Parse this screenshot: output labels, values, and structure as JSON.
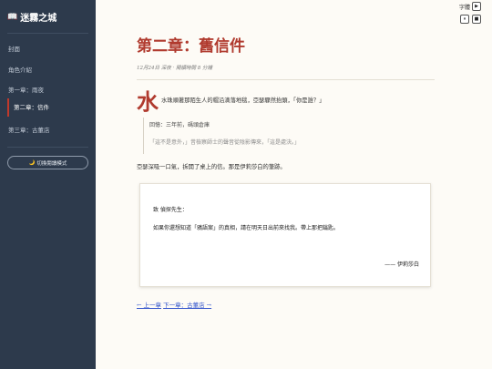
{
  "sidebar": {
    "brand_icon": "open-book-icon",
    "brand_icon_glyph": "📖",
    "brand_title": "迷霧之城",
    "items": [
      {
        "label": "封面"
      },
      {
        "label": "角色介紹"
      },
      {
        "label": "第一章：雨夜"
      },
      {
        "label": "第二章：信件"
      },
      {
        "label": "第三章：古董店"
      }
    ],
    "mode_icon": "🌙",
    "mode_label": "切換閱讀模式"
  },
  "controls": {
    "font_label": "字體",
    "play_glyph": "▶",
    "pause_glyph": "⏸",
    "stop_glyph": "■"
  },
  "chapter": {
    "title": "第二章：舊信件",
    "meta": "12月24日 深夜 · 閱讀時間 8 分鐘",
    "dropcap": "水",
    "para1": "水珠順著那陌生人的帽沿滴落地毯，亞瑟驟然抬頭，「你是誰？」",
    "flashback_heading": "回憶：三年前，碼頭倉庫",
    "flashback_quote": "「這不是意外，」昔檢察師士的聲音從陰影傳來，「這是處決。」",
    "para2": "亞瑟深吸一口氣，拆開了桌上的信。那是伊莉莎白的筆跡。"
  },
  "letter": {
    "greeting": "致 偵探先生：",
    "body": "如果你還想知道「鴉語案」的真相，請在明天日出前來找我。帶上那把鑰匙。",
    "signature": "—— 伊莉莎白"
  },
  "navigation": {
    "prev": "← 上一章",
    "next": "下一章：古董店 →"
  },
  "colors": {
    "accent": "#b03a2e",
    "sidebar_bg": "#2d3a4c",
    "page_bg": "#fdfbf6"
  }
}
